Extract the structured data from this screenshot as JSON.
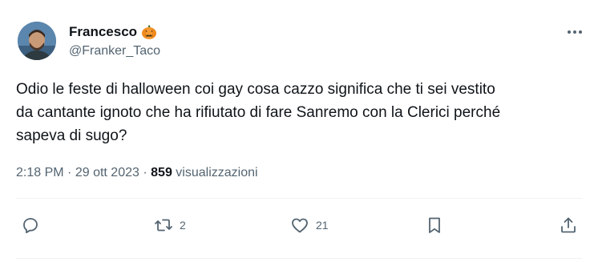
{
  "author": {
    "display_name": "Francesco",
    "name_emoji": "pumpkin-icon",
    "handle": "@Franker_Taco"
  },
  "tweet": {
    "text_lines": [
      "Odio le feste di halloween coi gay cosa cazzo significa che ti sei vestito",
      "da cantante ignoto che ha rifiutato di fare Sanremo con la Clerici perché",
      "sapeva di sugo?"
    ],
    "time": "2:18 PM",
    "separator": "·",
    "date": "29 ott 2023",
    "views_count": "859",
    "views_label": "visualizzazioni"
  },
  "actions": {
    "reply": {
      "icon": "reply-icon",
      "count": ""
    },
    "retweet": {
      "icon": "retweet-icon",
      "count": "2"
    },
    "like": {
      "icon": "heart-icon",
      "count": "21"
    },
    "bookmark": {
      "icon": "bookmark-icon",
      "count": ""
    },
    "share": {
      "icon": "share-icon",
      "count": ""
    }
  },
  "colors": {
    "text_primary": "#0f1419",
    "text_secondary": "#536471",
    "divider": "#eff3f4"
  }
}
